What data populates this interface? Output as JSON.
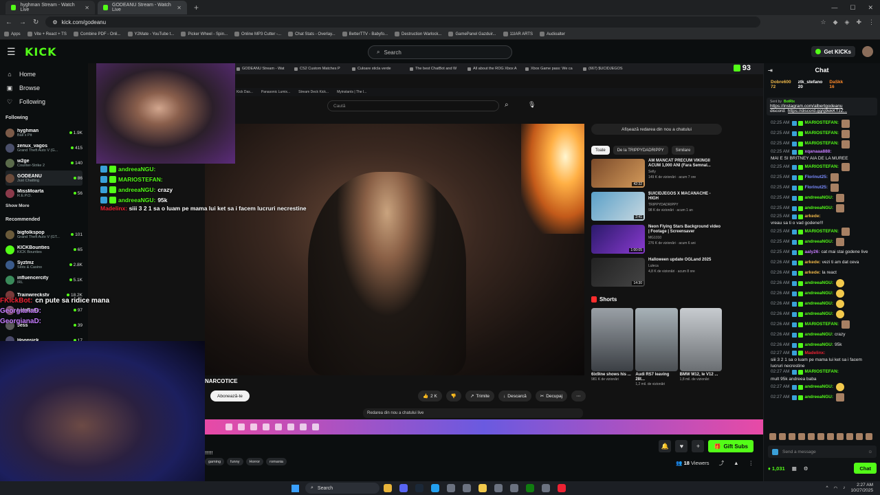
{
  "browser": {
    "tabs": [
      {
        "title": "hyghman Stream - Watch Live",
        "active": false
      },
      {
        "title": "GODEANU Stream - Watch Live",
        "active": true
      }
    ],
    "new_tab": "+",
    "url": "kick.com/godeanu",
    "window_controls": [
      "—",
      "☐",
      "✕"
    ],
    "bookmarks": [
      "Apps",
      "Vite + React + TS",
      "Combine PDF - Onli...",
      "Y2Mate - YouTube t...",
      "Picker Wheel - Spin...",
      "Online MP3 Cutter -...",
      "Chat Stats - Overlay...",
      "BetterTTV - Babyfo...",
      "Destruction Warlock...",
      "GamePanel Gazduir...",
      "11IAR ARTS",
      "Audioalter"
    ]
  },
  "header": {
    "logo": "KICK",
    "search_placeholder": "Search",
    "get_kicks": "Get KICKs"
  },
  "sidebar": {
    "nav": [
      {
        "icon": "⌂",
        "label": "Home"
      },
      {
        "icon": "▣",
        "label": "Browse"
      },
      {
        "icon": "♡",
        "label": "Following"
      }
    ],
    "following_title": "Following",
    "following": [
      {
        "name": "hyghman",
        "category": "Ball x Pit",
        "viewers": "1.9K",
        "avatar_color": "#7b5a48"
      },
      {
        "name": "zenux_vagos",
        "category": "Grand Theft Auto V (G...",
        "viewers": "415",
        "avatar_color": "#4a4f6a"
      },
      {
        "name": "w2ge",
        "category": "Counter-Strike 2",
        "viewers": "140",
        "avatar_color": "#5a6a4a"
      },
      {
        "name": "GODEANU",
        "category": "Just Chatting",
        "viewers": "86",
        "avatar_color": "#6a4a3a"
      },
      {
        "name": "MissMoarta",
        "category": "R.E.P.O.",
        "viewers": "56",
        "avatar_color": "#8a3a4a"
      }
    ],
    "show_more": "Show More",
    "recommended_title": "Recommended",
    "recommended": [
      {
        "name": "bigfolkspop",
        "category": "Grand Theft Auto V (GT...",
        "viewers": "101",
        "avatar_color": "#6a5a3a"
      },
      {
        "name": "KICKBounties",
        "category": "KICK Bounties",
        "viewers": "65",
        "avatar_color": "#53fc18"
      },
      {
        "name": "Syztmz",
        "category": "Slots & Casino",
        "viewers": "2.8K",
        "avatar_color": "#3a5a8a"
      },
      {
        "name": "influencercity",
        "category": "IRL",
        "viewers": "5.1K",
        "avatar_color": "#3a8a5a"
      },
      {
        "name": "Trainwreckstv",
        "category": "",
        "viewers": "18.2K",
        "avatar_color": "#7a3a3a"
      },
      {
        "name": "LolaBunz",
        "category": "",
        "viewers": "97",
        "avatar_color": "#8a5a7a"
      },
      {
        "name": "Jess",
        "category": "",
        "viewers": "39",
        "avatar_color": "#5a5a5a"
      },
      {
        "name": "Hoopsick",
        "category": "",
        "viewers": "17",
        "avatar_color": "#4a4a6a"
      }
    ]
  },
  "stream": {
    "inner_tabs": [
      "GODEANU Stream - Wat",
      "CS2 Custom Matches P",
      "Culoare sticla verde",
      "The best ChatBot and W",
      "All about the ROG Xbox A",
      "Xbox Game pass: We ca",
      "(667) $UCIDJEGOS"
    ],
    "inner_points": "93",
    "inner_bookmarks": [
      "Kick Das...",
      "Panasonic Lumix...",
      "Stream Deck Kick...",
      "Myinstants | The l..."
    ],
    "yt_search_placeholder": "Caută",
    "yt_video_title": "NARCOTICE",
    "yt_subscribe": "Abonează-te",
    "yt_actions": {
      "like": "2 K",
      "share": "Trimite",
      "download": "Descarcă",
      "clip": "Decupaj"
    },
    "yt_replay_bar": "Redarea din nou a chatului live",
    "yt_replay_button": "Afișează redarea din nou a chatului",
    "yt_chips": [
      {
        "label": "Toate",
        "selected": true
      },
      {
        "label": "De la TRIPPYDADRIPPY",
        "selected": false
      },
      {
        "label": "Similare",
        "selected": false
      }
    ],
    "yt_recs": [
      {
        "title": "AM MANCAT PRECUM VIKINGII ACUM 1,000 ANI (Fara Semnal...",
        "channel": "Selly",
        "meta": "149 K de vizionări · acum 7 ore",
        "duration": "42:32"
      },
      {
        "title": "$UICIDJEGOS X MACANACHE - HIGH",
        "channel": "TRIPPYDADRIPPY",
        "meta": "98 K de vizionări · acum 1 an",
        "duration": "2:41"
      },
      {
        "title": "Neon Flying Stars Background video | Footage | Screensaver",
        "channel": "MG1010",
        "meta": "276 K de vizionări · acum 6 ani",
        "duration": "1:00:05"
      },
      {
        "title": "Halloween update OGLand 2025",
        "channel": "Luleca",
        "meta": "4,8 K de vizionări · acum 8 ore",
        "duration": "14:30"
      }
    ],
    "shorts_title": "Shorts",
    "shorts": [
      {
        "title": "6ix9ine shows his ...",
        "meta": "981 K de vizionări"
      },
      {
        "title": "Audi RS7 leaving 28t...",
        "meta": "1,2 mil. de vizionări"
      },
      {
        "title": "BMW M12, le V12 ...",
        "meta": "1,8 mil. de vizionări"
      }
    ],
    "overlay_chat": [
      {
        "user": "andreeaNGU:",
        "text": ""
      },
      {
        "user": "MARIOSTEFAN:",
        "text": ""
      },
      {
        "user": "andreeaNGU:",
        "text": "crazy"
      },
      {
        "user": "andreeaNGU:",
        "text": "95k"
      }
    ],
    "overlay_msg_user": "Madelinx:",
    "overlay_msg_text": "siii 3 2 1 sa o luam pe mama lui ket sa i facem lucruri necrestine",
    "ext_overlay": [
      {
        "user": "FKickBot:",
        "text": "cn pute sa ridice mana",
        "cls": "u1"
      },
      {
        "user": "GeorgianaD:",
        "text": "",
        "cls": "u2"
      },
      {
        "user": "GeorgianaD:",
        "text": "",
        "cls": "u2"
      }
    ]
  },
  "info": {
    "title": "!!!!!!",
    "tags": [
      "gaming",
      "funny",
      "Horror",
      "romania"
    ],
    "gift_subs": "Gift Subs",
    "viewers_count": "18",
    "viewers_label": "Viewers"
  },
  "chat": {
    "title": "Chat",
    "leaderboard": [
      {
        "name": "Dobre600",
        "value": "72",
        "cls": "c1"
      },
      {
        "name": "ztk_stefano",
        "value": "20",
        "cls": "c2"
      },
      {
        "name": "DaSkk",
        "value": "16",
        "cls": "c3"
      }
    ],
    "pinned_sent_by": "Sent by",
    "pinned_user": "BotRix",
    "pinned_link1": "https://instagram.com/albertgodeanu",
    "pinned_link2": "https://discord.gg/g9ekKTzZ...",
    "pinned_label2": "discord:",
    "messages": [
      {
        "time": "02:25 AM",
        "user": "MARIOSTEFAN:",
        "color": "#53fc18",
        "text": "",
        "emote": "e"
      },
      {
        "time": "02:25 AM",
        "user": "MARIOSTEFAN:",
        "color": "#53fc18",
        "text": "",
        "emote": "e"
      },
      {
        "time": "02:25 AM",
        "user": "MARIOSTEFAN:",
        "color": "#53fc18",
        "text": "",
        "emote": "e"
      },
      {
        "time": "02:25 AM",
        "user": "xqanaaa888:",
        "color": "#c77dff",
        "text": "MAI E SI BRITNEY AIA DE LA MUREE",
        "emote": ""
      },
      {
        "time": "02:25 AM",
        "user": "MARIOSTEFAN:",
        "color": "#53fc18",
        "text": "",
        "emote": "e"
      },
      {
        "time": "02:25 AM",
        "user": "Florinut25:",
        "color": "#7a8cff",
        "text": "",
        "emote": "e"
      },
      {
        "time": "02:25 AM",
        "user": "Florinut25:",
        "color": "#7a8cff",
        "text": "",
        "emote": "e"
      },
      {
        "time": "02:25 AM",
        "user": "andreeaNGU:",
        "color": "#53fc18",
        "text": "",
        "emote": "e"
      },
      {
        "time": "02:25 AM",
        "user": "andreeaNGU:",
        "color": "#53fc18",
        "text": "",
        "emote": "e"
      },
      {
        "time": "02:25 AM",
        "user": "arkede:",
        "color": "#f0b94a",
        "text": "vreau sa ti o vad godene!!!",
        "emote": ""
      },
      {
        "time": "02:25 AM",
        "user": "MARIOSTEFAN:",
        "color": "#53fc18",
        "text": "",
        "emote": "e"
      },
      {
        "time": "02:25 AM",
        "user": "andreeaNGU:",
        "color": "#53fc18",
        "text": "",
        "emote": "e"
      },
      {
        "time": "02:25 AM",
        "user": "aaly26:",
        "color": "#c77dff",
        "text": "cat mai stai godene live",
        "emote": ""
      },
      {
        "time": "02:26 AM",
        "user": "arkede:",
        "color": "#f0b94a",
        "text": "vezi ti am dat ceva",
        "emote": ""
      },
      {
        "time": "02:26 AM",
        "user": "arkede:",
        "color": "#f0b94a",
        "text": "la react",
        "emote": ""
      },
      {
        "time": "02:26 AM",
        "user": "andreeaNGU:",
        "color": "#53fc18",
        "text": "",
        "emote": "y"
      },
      {
        "time": "02:26 AM",
        "user": "andreeaNGU:",
        "color": "#53fc18",
        "text": "",
        "emote": "y"
      },
      {
        "time": "02:26 AM",
        "user": "andreeaNGU:",
        "color": "#53fc18",
        "text": "",
        "emote": "y"
      },
      {
        "time": "02:26 AM",
        "user": "andreeaNGU:",
        "color": "#53fc18",
        "text": "",
        "emote": "y"
      },
      {
        "time": "02:26 AM",
        "user": "MARIOSTEFAN:",
        "color": "#53fc18",
        "text": "",
        "emote": "e"
      },
      {
        "time": "02:26 AM",
        "user": "andreeaNGU:",
        "color": "#53fc18",
        "text": "crazy",
        "emote": ""
      },
      {
        "time": "02:26 AM",
        "user": "andreeaNGU:",
        "color": "#53fc18",
        "text": "95k",
        "emote": ""
      },
      {
        "time": "02:27 AM",
        "user": "Madelinx:",
        "color": "#e23",
        "text": "siii 3 2 1 sa o luam pe mama lui ket sa i facem lucruri necrestine",
        "emote": ""
      },
      {
        "time": "02:27 AM",
        "user": "MARIOSTEFAN:",
        "color": "#53fc18",
        "text": "mult 95k andreea baba",
        "emote": ""
      },
      {
        "time": "02:27 AM",
        "user": "andreeaNGU:",
        "color": "#53fc18",
        "text": "",
        "emote": "y"
      },
      {
        "time": "02:27 AM",
        "user": "andreeaNGU:",
        "color": "#53fc18",
        "text": "",
        "emote": "e"
      }
    ],
    "input_placeholder": "Send a message",
    "points": "1,031",
    "chat_button": "Chat"
  },
  "os": {
    "search": "Search",
    "lang": "ENG",
    "time": "2:27 AM",
    "date": "10/27/2025"
  }
}
